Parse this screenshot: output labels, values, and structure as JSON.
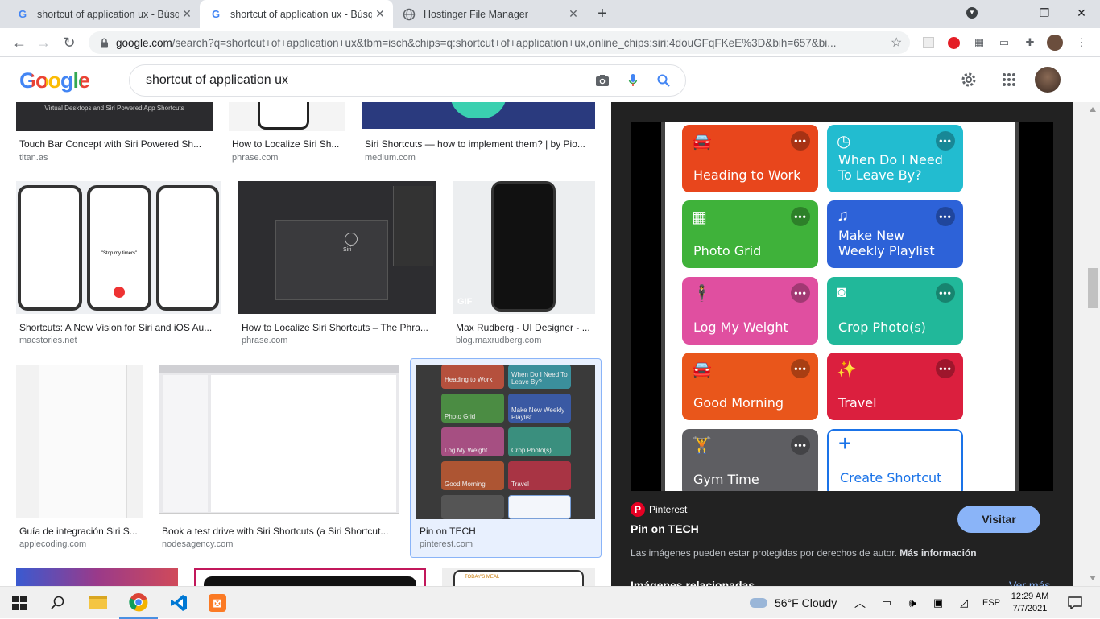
{
  "browser": {
    "tabs": [
      {
        "title": "shortcut of application ux - Búsq",
        "favicon": "google-icon"
      },
      {
        "title": "shortcut of application ux - Búsq",
        "favicon": "google-icon"
      },
      {
        "title": "Hostinger File Manager",
        "favicon": "globe-icon"
      }
    ],
    "url_host": "google.com",
    "url_rest": "/search?q=shortcut+of+application+ux&tbm=isch&chips=q:shortcut+of+application+ux,online_chips:siri:4douGFqFKeE%3D&bih=657&bi..."
  },
  "google": {
    "logo": "Google",
    "query": "shortcut of application ux"
  },
  "results": [
    {
      "caption": "Touch Bar Concept with Siri Powered Sh...",
      "source": "titan.as",
      "thumb_text": "Virtual Desktops and Siri Powered App Shortcuts"
    },
    {
      "caption": "How to Localize Siri Sh...",
      "source": "phrase.com"
    },
    {
      "caption": "Siri Shortcuts — how to implement them? | by Pio...",
      "source": "medium.com"
    },
    {
      "caption": "Shortcuts: A New Vision for Siri and iOS Au...",
      "source": "macstories.net",
      "thumb_text": "\"Stop my timers\""
    },
    {
      "caption": "How to Localize Siri Shortcuts – The Phra...",
      "source": "phrase.com",
      "thumb_text": "Siri"
    },
    {
      "caption": "Max Rudberg - UI Designer - ...",
      "source": "blog.maxrudberg.com",
      "thumb_text": "GIF"
    },
    {
      "caption": "Guía de integración Siri S...",
      "source": "applecoding.com"
    },
    {
      "caption": "Book a test drive with Siri Shortcuts (a Siri Shortcut...",
      "source": "nodesagency.com"
    },
    {
      "caption": "Pin on TECH",
      "source": "pinterest.com"
    },
    {
      "caption": "",
      "source": "",
      "thumb_text": "TODAY'S MEAL"
    }
  ],
  "mini_shortcuts": [
    "Heading to Work",
    "When Do I Need To Leave By?",
    "Photo Grid",
    "Make New Weekly Playlist",
    "Log My Weight",
    "Crop Photo(s)",
    "Good Morning",
    "Travel"
  ],
  "preview": {
    "shortcuts": [
      {
        "label": "Heading to Work",
        "icon": "car-icon",
        "color": "#e8461c"
      },
      {
        "label": "When Do I Need To Leave By?",
        "icon": "clock-icon",
        "color": "#22bcd0"
      },
      {
        "label": "Photo Grid",
        "icon": "grid-icon",
        "color": "#3fb23a"
      },
      {
        "label": "Make New Weekly Playlist",
        "icon": "music-icon",
        "color": "#2d62d8"
      },
      {
        "label": "Log My Weight",
        "icon": "person-icon",
        "color": "#e04fa0"
      },
      {
        "label": "Crop Photo(s)",
        "icon": "camera-icon",
        "color": "#21b89a"
      },
      {
        "label": "Good Morning",
        "icon": "car-icon",
        "color": "#e9561b"
      },
      {
        "label": "Travel",
        "icon": "wand-icon",
        "color": "#db1f3e"
      },
      {
        "label": "Gym Time",
        "icon": "gym-icon",
        "color": "#5e5e62"
      },
      {
        "label": "Create Shortcut",
        "icon": "plus-icon",
        "color": "#ffffff"
      }
    ],
    "site": "Pinterest",
    "title": "Pin on TECH",
    "visit_label": "Visitar",
    "copyright": "Las imágenes pueden estar protegidas por derechos de autor.",
    "more_info": "Más información",
    "related": "Imágenes relacionadas",
    "see_more": "Ver más"
  },
  "taskbar": {
    "weather": "56°F  Cloudy",
    "lang": "ESP",
    "time": "12:29 AM",
    "date": "7/7/2021"
  }
}
